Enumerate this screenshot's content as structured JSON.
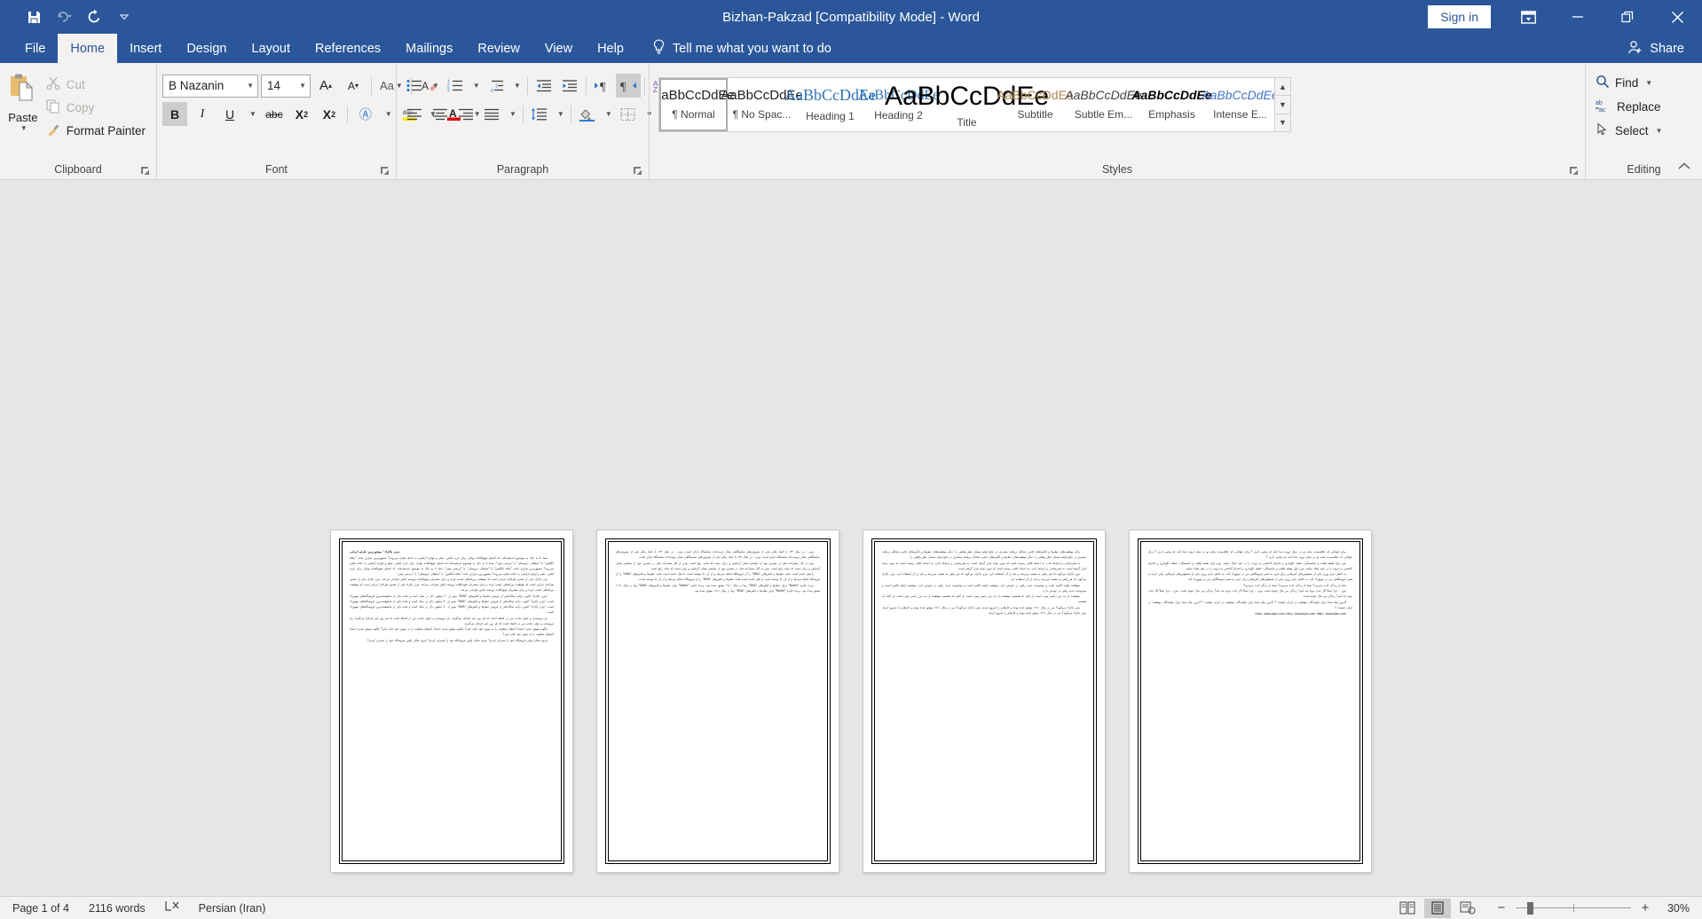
{
  "titlebar": {
    "title": "Bizhan-Pakzad [Compatibility Mode]  -  Word",
    "signin_label": "Sign in",
    "qat": [
      {
        "name": "save-icon",
        "label": "Save"
      },
      {
        "name": "undo-icon",
        "label": "Undo"
      },
      {
        "name": "redo-icon",
        "label": "Redo"
      },
      {
        "name": "customize-quick-access-toolbar-icon",
        "label": "Customize Quick Access Toolbar"
      }
    ],
    "window_buttons": [
      {
        "name": "ribbon-display-options-icon",
        "label": "Ribbon Display Options"
      },
      {
        "name": "minimize-icon",
        "label": "Minimize"
      },
      {
        "name": "restore-icon",
        "label": "Restore Down"
      },
      {
        "name": "close-icon",
        "label": "Close"
      }
    ]
  },
  "tabs": [
    {
      "label": "File",
      "active": false
    },
    {
      "label": "Home",
      "active": true
    },
    {
      "label": "Insert",
      "active": false
    },
    {
      "label": "Design",
      "active": false
    },
    {
      "label": "Layout",
      "active": false
    },
    {
      "label": "References",
      "active": false
    },
    {
      "label": "Mailings",
      "active": false
    },
    {
      "label": "Review",
      "active": false
    },
    {
      "label": "View",
      "active": false
    },
    {
      "label": "Help",
      "active": false
    }
  ],
  "tellme": {
    "placeholder": "Tell me what you want to do",
    "icon": "lightbulb-icon"
  },
  "share": {
    "label": "Share",
    "icon": "share-person-icon"
  },
  "ribbon": {
    "clipboard": {
      "group_label": "Clipboard",
      "paste_label": "Paste",
      "items": [
        {
          "label": "Cut",
          "icon": "scissors-icon",
          "enabled": false
        },
        {
          "label": "Copy",
          "icon": "copy-icon",
          "enabled": false
        },
        {
          "label": "Format Painter",
          "icon": "format-painter-icon",
          "enabled": true
        }
      ]
    },
    "font": {
      "group_label": "Font",
      "font_name": "B Nazanin",
      "font_size": "14",
      "buttons_row1": [
        {
          "name": "grow-font-button",
          "glyph": "A▴"
        },
        {
          "name": "shrink-font-button",
          "glyph": "A▾"
        },
        {
          "name": "change-case-button",
          "glyph": "Aa"
        },
        {
          "name": "clear-formatting-button",
          "glyph": "A◆"
        }
      ],
      "buttons_row2": [
        {
          "name": "bold-button",
          "glyph": "B",
          "active": true
        },
        {
          "name": "italic-button",
          "glyph": "I",
          "active": false
        },
        {
          "name": "underline-button",
          "glyph": "U",
          "active": false
        },
        {
          "name": "strikethrough-button",
          "glyph": "abc",
          "active": false
        },
        {
          "name": "subscript-button",
          "glyph": "X₂",
          "active": false
        },
        {
          "name": "superscript-button",
          "glyph": "X²",
          "active": false
        },
        {
          "name": "text-effects-button",
          "glyph": "A",
          "active": false
        },
        {
          "name": "text-highlight-color-button",
          "glyph": "ab",
          "active": false
        },
        {
          "name": "font-color-button",
          "glyph": "A",
          "active": false
        }
      ]
    },
    "paragraph": {
      "group_label": "Paragraph",
      "buttons_row1": [
        {
          "name": "bullets-button",
          "glyph": "☰"
        },
        {
          "name": "numbering-button",
          "glyph": "☰"
        },
        {
          "name": "multilevel-list-button",
          "glyph": "☰"
        },
        {
          "name": "decrease-indent-button",
          "glyph": "⇤"
        },
        {
          "name": "increase-indent-button",
          "glyph": "⇥"
        },
        {
          "name": "left-to-right-text-direction-button",
          "glyph": "¶",
          "active": false
        },
        {
          "name": "right-to-left-text-direction-button",
          "glyph": "¶",
          "active": true
        },
        {
          "name": "sort-button",
          "glyph": "A↓"
        },
        {
          "name": "show-formatting-marks-button",
          "glyph": "¶"
        }
      ],
      "buttons_row2": [
        {
          "name": "align-left-button",
          "glyph": "☰"
        },
        {
          "name": "align-center-button",
          "glyph": "☰"
        },
        {
          "name": "align-right-button",
          "glyph": "☰"
        },
        {
          "name": "justify-button",
          "glyph": "☰"
        },
        {
          "name": "line-and-paragraph-spacing-button",
          "glyph": "↕"
        },
        {
          "name": "shading-button",
          "glyph": "◢"
        },
        {
          "name": "borders-button",
          "glyph": "▦"
        }
      ]
    },
    "styles": {
      "group_label": "Styles",
      "items": [
        {
          "name": "Normal",
          "preview": "AaBbCcDdEe",
          "mark": "¶",
          "selected": true,
          "color": "#222222",
          "size": "15px",
          "weight": "normal",
          "style": "normal",
          "serif": false
        },
        {
          "name": "No Spac...",
          "preview": "AaBbCcDdEe",
          "mark": "¶",
          "selected": false,
          "color": "#222222",
          "size": "15px",
          "weight": "normal",
          "style": "normal",
          "serif": false
        },
        {
          "name": "Heading 1",
          "preview": "AaBbCcDdEe",
          "mark": "",
          "selected": false,
          "color": "#2e74b5",
          "size": "18px",
          "weight": "normal",
          "style": "normal",
          "serif": true
        },
        {
          "name": "Heading 2",
          "preview": "AaBbCcDdEe",
          "mark": "",
          "selected": false,
          "color": "#2e74b5",
          "size": "16px",
          "weight": "normal",
          "style": "normal",
          "serif": true
        },
        {
          "name": "Title",
          "preview": "AaBbCcDdEe",
          "mark": "",
          "selected": false,
          "color": "#000000",
          "size": "30px",
          "weight": "normal",
          "style": "normal",
          "serif": false
        },
        {
          "name": "Subtitle",
          "preview": "AaBbCcDdEe",
          "mark": "",
          "selected": false,
          "color": "#b08a50",
          "size": "14px",
          "weight": "normal",
          "style": "normal",
          "serif": false
        },
        {
          "name": "Subtle Em...",
          "preview": "AaBbCcDdEe",
          "mark": "",
          "selected": false,
          "color": "#404040",
          "size": "14px",
          "weight": "normal",
          "style": "italic",
          "serif": false
        },
        {
          "name": "Emphasis",
          "preview": "AaBbCcDdEe",
          "mark": "",
          "selected": false,
          "color": "#000000",
          "size": "14px",
          "weight": "bold",
          "style": "italic",
          "serif": false
        },
        {
          "name": "Intense E...",
          "preview": "AaBbCcDdEe",
          "mark": "",
          "selected": false,
          "color": "#4472c4",
          "size": "14px",
          "weight": "normal",
          "style": "italic",
          "serif": false
        }
      ],
      "scroll_buttons": [
        {
          "name": "styles-scroll-up-button",
          "glyph": "▲"
        },
        {
          "name": "styles-scroll-down-button",
          "glyph": "▼"
        },
        {
          "name": "styles-more-button",
          "glyph": "▼"
        }
      ]
    },
    "editing": {
      "group_label": "Editing",
      "items": [
        {
          "label": "Find",
          "icon": "search-icon",
          "has_caret": true
        },
        {
          "label": "Replace",
          "icon": "replace-icon",
          "has_caret": false
        },
        {
          "label": "Select",
          "icon": "select-pointer-icon",
          "has_caret": true
        }
      ]
    },
    "collapse_ribbon": {
      "name": "collapse-ribbon-icon",
      "glyph": "⌃"
    }
  },
  "document": {
    "pages": [
      {
        "number": 1,
        "title": "بیژن پاکزاد\" موفق‌ترین طراح ایرانی",
        "paragraphs": [
          "شما تا به حال به موضوع اندیشیده‌اید که اشیای فوق‌العاده پولدار برای خرید لباس، عطر و لوازم آرایشی به کدام مغازه می‌روند؟ مشهورترین قراری مانند \"ملکه انگلیس\" یا \"سلطان عروستان\" یا \"بردسی بپیتز\".",
          "بیژن پاکزاد یکی از معدود طراحان ایرانی است که موفقیت بین‌المللی کسب کرده و برای مشتریان فوق‌العاده ثروتمند لباس طراحی می‌کند.",
          "\"بیژن پاکزاد\" اکنون درآمد سالانه‌اش از فروش عطرها و لباس‌های \"DNA\" بیش از ۴۰ میلیون دلار در سال است و مانند یکی از شکوهمندترین فروشگاه‌های نیویورک است.",
          "راز نیرومندی و جوان ماندن من در لحظه است که هر روز چیز تازه‌ای می‌گیرم.",
          "چگونه موفق شدی اعتماد آدم‌های متفاوت را به سوی خود جلب کنی؟",
          "چروه سالی اولین فروشگاه خود را متمرکز کردی؟"
        ]
      },
      {
        "number": 2,
        "title": "",
        "paragraphs": [
          "بیژن ، در سال ۱۳۲ با کمک مالی یکی از معروف‌های نمایشگاهی مجاز تربیت‌داده نمایشگاه دارای است.",
          "بیژن از آثار مشارکت قبل در بستری نبود از نمایشی همان آزمایش و برای دست که مانند رایج است.",
          "با قبل کننده است مانند عطرها و لباس‌های \"DNA\" را از فروشگاه انجام می‌دهد و از آن جا نوشته است.",
          "برنده جایزه \"Nobel\" برای عطرها و لباس‌های \"DNA\" زیبا در سال ۱۹۱۱ موفق شده بود."
        ]
      },
      {
        "number": 3,
        "title": "",
        "paragraphs": [
          "دیگر موقعیت‌های عطرها و انگیزه‌های جانبی نشانگر دریافت بیشتری در نتایج اولیه مستار عطر واقعی را.",
          "به هم‌رساندن و ارتباط دادن، به اعتماد کافی رسیده است که مورد توجه قرار گرفته است.",
          "بیژن پاکزاد می‌گوید که هر راهی به مقصد می‌رسد و باید از آن استفاده کرد.",
          "موفقیت اولیه انگیزه است و موجودیت جدید راهی در خودش دارد.",
          "موفقیت از دید من راضی بودن است، از آنچه که هستیم.",
          "بیژن باکزاد می‌گوید؟ من در سال ۱۹۱۱ موفق شده بودم و کارهایم را شروع کردم."
        ]
      },
      {
        "number": 4,
        "title": "",
        "paragraphs": [
          "برای جوانانی که علاقه‌مندند مانند تو در دنیای ثروت شنا کنند چه پیامی داری ؟",
          "بیژن اول طبقه لیاقت و شایستگی، حفظ، نگهداری و احترام گذاشتن به ثروت را در خود ایجاد نمایید.",
          "به خاطر دارم روزی یکی از مسئولین‌های آمریکایی برای خرید به قصر فروشگاهی من در نیویورک آمد.",
          "شما از زندگی لذت می‌برید؟",
          "بیژن ، چرا اصلاً اگر لذت نبرم چه کنم؟ زندگی من مال خودم است.",
          "آخرین پیام شما برای خوانندگان موفقیت در ایران چیست ؟",
          "http:/ www.bijan.com"
        ]
      }
    ]
  },
  "statusbar": {
    "page_info": "Page 1 of 4",
    "word_count": "2116 words",
    "proofing_icon": "proofing-errors-icon",
    "language": "Persian (Iran)",
    "views": [
      {
        "name": "read-mode-view-button",
        "label": "Read Mode",
        "active": false
      },
      {
        "name": "print-layout-view-button",
        "label": "Print Layout",
        "active": true
      },
      {
        "name": "web-layout-view-button",
        "label": "Web Layout",
        "active": false
      }
    ],
    "zoom": {
      "out_label": "−",
      "in_label": "+",
      "value": "30%",
      "percent": 30
    }
  }
}
